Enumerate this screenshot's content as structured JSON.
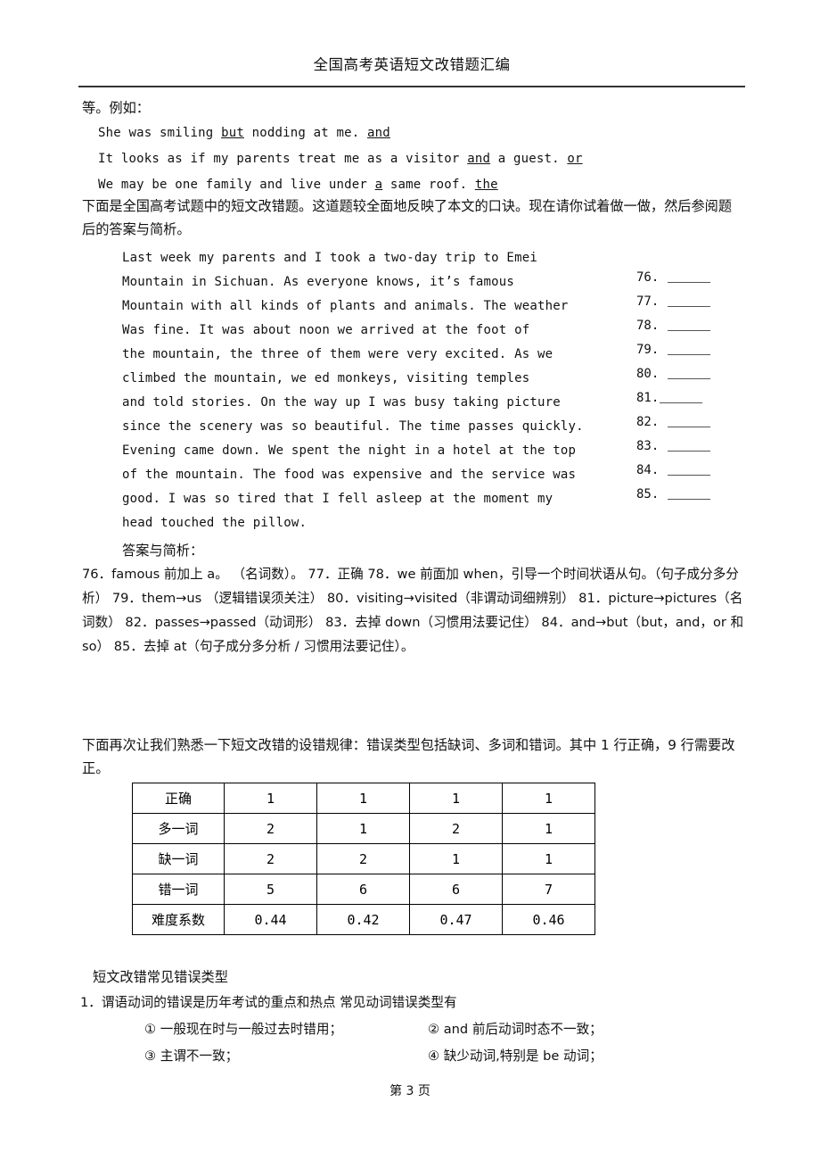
{
  "header": {
    "title": "全国高考英语短文改错题汇编"
  },
  "intro": {
    "line": "等。例如：",
    "examples": [
      {
        "pre": "She was smiling ",
        "err": "but",
        "mid": " nodding at me. ",
        "fix": "and"
      },
      {
        "pre": "It looks as if my parents treat me as a visitor ",
        "err": "and",
        "mid": " a guest. ",
        "fix": "or"
      },
      {
        "pre": "We may be one family and live under ",
        "err": "a",
        "mid": " same roof. ",
        "fix": "the"
      }
    ],
    "instruction": "下面是全国高考试题中的短文改错题。这道题较全面地反映了本文的口诀。现在请你试着做一做，然后参阅题后的答案与简析。"
  },
  "passage": {
    "lines": [
      "Last week my parents and I took a two-day trip to Emei",
      "Mountain in Sichuan. As everyone knows, it’s famous",
      "Mountain with all kinds of plants and animals. The weather",
      "Was fine. It was about noon we arrived at the foot of",
      "the mountain, the three of them were very excited. As we",
      "climbed the mountain, we ed monkeys, visiting temples",
      "and told stories. On the way up I was busy taking picture",
      "since the scenery was so beautiful. The time passes quickly.",
      "Evening came down. We spent the night in a hotel at the top",
      "of the mountain. The food was expensive and the service was",
      "good. I was so tired that I fell asleep at the moment my",
      "head touched the pillow."
    ],
    "blanks": [
      {
        "num": "76.",
        "tight": false
      },
      {
        "num": "77.",
        "tight": false
      },
      {
        "num": "78.",
        "tight": false
      },
      {
        "num": "79.",
        "tight": false
      },
      {
        "num": "80.",
        "tight": false
      },
      {
        "num": "81.",
        "tight": true
      },
      {
        "num": "82.",
        "tight": false
      },
      {
        "num": "83.",
        "tight": false
      },
      {
        "num": "84.",
        "tight": false
      },
      {
        "num": "85.",
        "tight": false
      }
    ]
  },
  "answers": {
    "heading": "答案与简析：",
    "body": "76．famous 前加上 a。 （名词数）。 77．正确 78．we 前面加 when，引导一个时间状语从句。（句子成分多分析） 79．them→us （逻辑错误须关注） 80．visiting→visited（非谓动词细辨别） 81．picture→pictures（名词数） 82．passes→passed（动词形） 83．去掉 down（习惯用法要记住） 84．and→but（but，and，or 和 so） 85．去掉 at（句子成分多分析 / 习惯用法要记住）。"
  },
  "rules": {
    "paragraph": "下面再次让我们熟悉一下短文改错的设错规律：错误类型包括缺词、多词和错词。其中 1 行正确，9 行需要改正。"
  },
  "stats_table": {
    "rows": [
      {
        "label": "正确",
        "values": [
          "1",
          "1",
          "1",
          "1"
        ]
      },
      {
        "label": "多一词",
        "values": [
          "2",
          "1",
          "2",
          "1"
        ]
      },
      {
        "label": "缺一词",
        "values": [
          "2",
          "2",
          "1",
          "1"
        ]
      },
      {
        "label": "错一词",
        "values": [
          "5",
          "6",
          "6",
          "7"
        ]
      },
      {
        "label": "难度系数",
        "values": [
          "0.44",
          "0.42",
          "0.47",
          "0.46"
        ]
      }
    ]
  },
  "error_types": {
    "heading": "短文改错常见错误类型",
    "item1": "1．谓语动词的错误是历年考试的重点和热点 常见动词错误类型有",
    "sub_items": [
      "①  一般现在时与一般过去时错用；",
      "②  and 前后动词时态不一致；",
      "③  主谓不一致；",
      "④  缺少动词,特别是 be 动词；"
    ]
  },
  "footer": {
    "page_label": "第 3 页"
  }
}
